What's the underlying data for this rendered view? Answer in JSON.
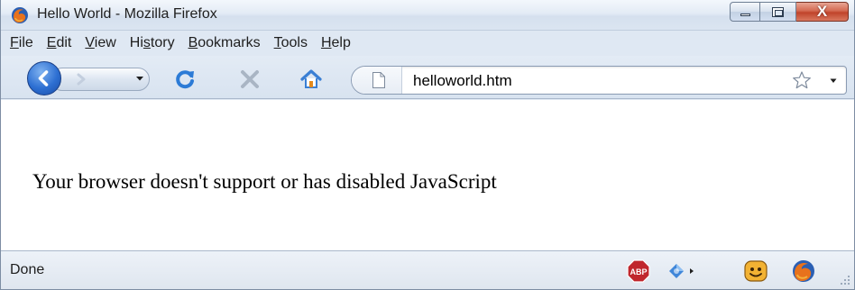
{
  "window": {
    "title": "Hello World - Mozilla Firefox",
    "icon": "firefox-icon",
    "controls": {
      "minimize_icon": "minimize-icon",
      "maximize_icon": "maximize-icon",
      "close_icon": "close-icon",
      "close_glyph": "X"
    }
  },
  "menu": [
    {
      "label": "File",
      "accel": "F",
      "rest": "ile"
    },
    {
      "label": "Edit",
      "accel": "E",
      "rest": "dit"
    },
    {
      "label": "View",
      "accel": "V",
      "rest": "iew"
    },
    {
      "label": "History",
      "pre": "Hi",
      "accel": "s",
      "rest": "tory"
    },
    {
      "label": "Bookmarks",
      "accel": "B",
      "rest": "ookmarks"
    },
    {
      "label": "Tools",
      "accel": "T",
      "rest": "ools"
    },
    {
      "label": "Help",
      "accel": "H",
      "rest": "elp"
    }
  ],
  "navigation": {
    "back_icon": "back-arrow-icon",
    "forward_icon": "forward-arrow-icon",
    "history_dropdown_icon": "dropdown-arrow-icon",
    "reload_icon": "reload-icon",
    "stop_icon": "stop-icon",
    "home_icon": "home-icon",
    "url": "helloworld.htm",
    "page_icon": "page-icon",
    "bookmark_icon": "star-icon",
    "url_dropdown_icon": "dropdown-arrow-icon"
  },
  "content": {
    "text": "Your browser doesn't support or has disabled JavaScript"
  },
  "status": {
    "text": "Done",
    "icons": [
      "adblock-plus-icon",
      "extension-icon",
      "smiley-icon",
      "firefox-icon"
    ]
  },
  "colors": {
    "chrome": "#dfe8f3",
    "close_button": "#c0432a",
    "back_button": "#2d6fd2",
    "reload": "#2c7bd6",
    "home": "#3a7fd4",
    "abp": "#c0272d"
  }
}
